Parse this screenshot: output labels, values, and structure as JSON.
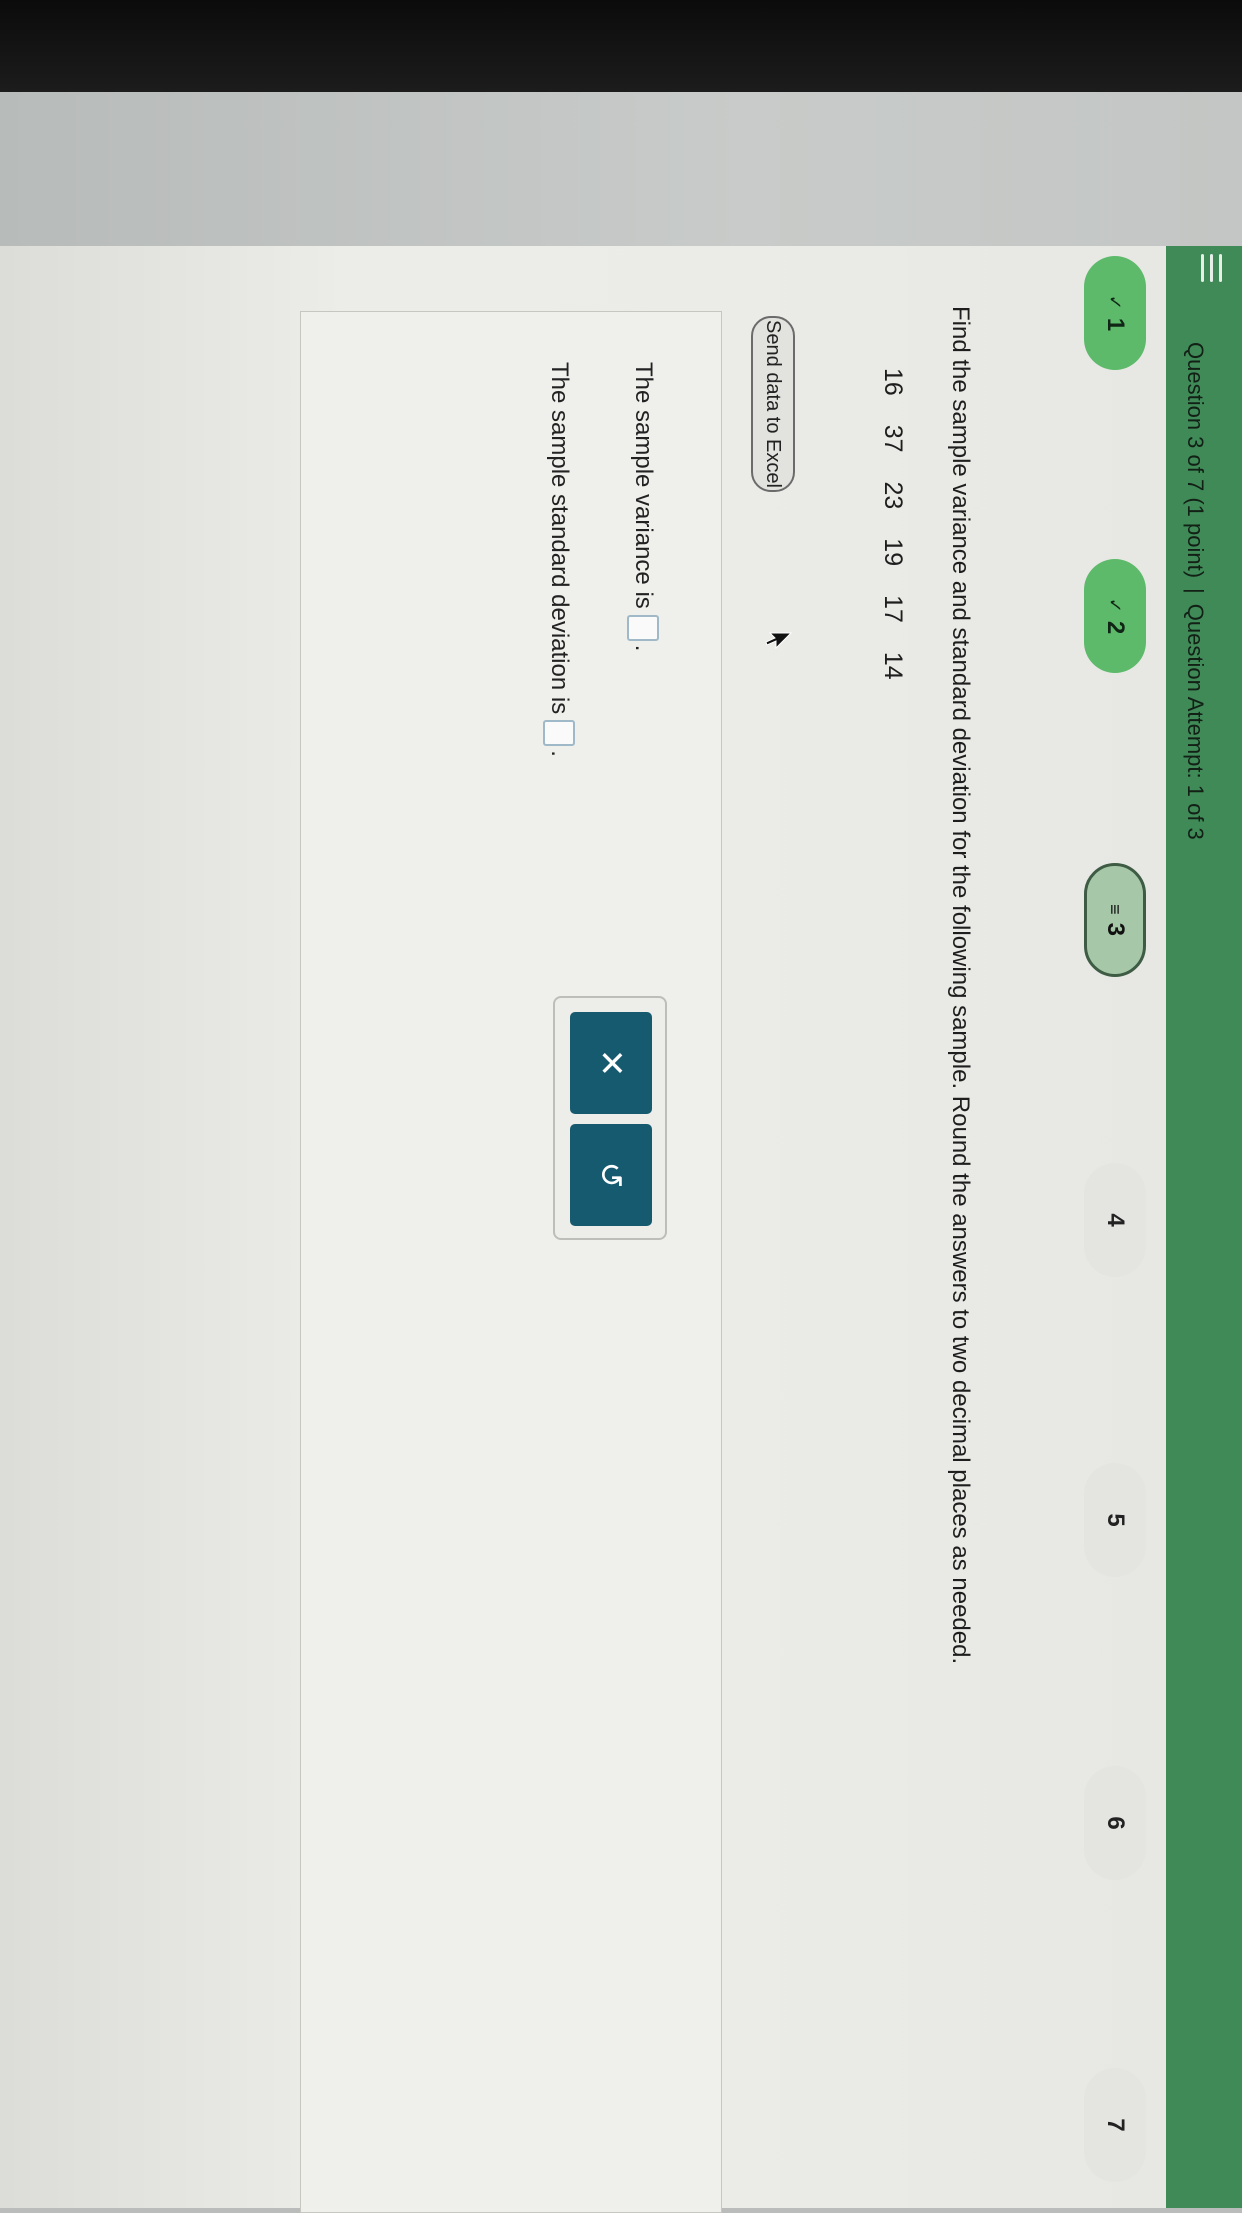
{
  "header": {
    "question_label": "Question 3 of 7 (1 point)",
    "separator": "|",
    "attempt_label": "Question Attempt: 1 of 3"
  },
  "question_nav": [
    {
      "label": "1",
      "mark": "✓",
      "state": "done"
    },
    {
      "label": "2",
      "mark": "✓",
      "state": "done"
    },
    {
      "label": "3",
      "mark": "≡",
      "state": "current"
    },
    {
      "label": "4",
      "mark": "",
      "state": "open"
    },
    {
      "label": "5",
      "mark": "",
      "state": "open"
    },
    {
      "label": "6",
      "mark": "",
      "state": "open"
    },
    {
      "label": "7",
      "mark": "",
      "state": "open"
    }
  ],
  "problem": {
    "prompt": "Find the sample variance and standard deviation for the following sample. Round the answers to two decimal places as needed.",
    "values": [
      "16",
      "37",
      "23",
      "19",
      "17",
      "14"
    ],
    "excel_button": "Send data to Excel"
  },
  "answers": {
    "variance_label": "The sample variance is",
    "variance_value": "",
    "stdev_label": "The sample standard deviation is",
    "stdev_value": "",
    "period": "."
  },
  "tools": {
    "clear_symbol": "✕",
    "reset_symbol": "↺"
  },
  "colors": {
    "header_green": "#3f8a57",
    "done_green": "#5cba6a",
    "tool_teal": "#165a6f"
  }
}
